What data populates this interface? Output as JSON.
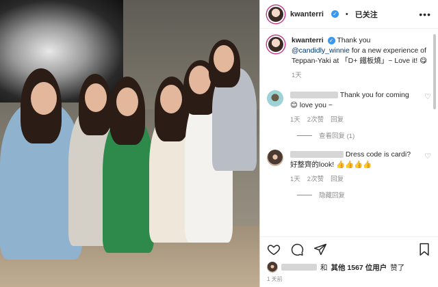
{
  "post": {
    "username": "kwanterri",
    "follow_status": "已关注",
    "verified": true,
    "more_icon": "more-horizontal-icon"
  },
  "caption": {
    "username": "kwanterri",
    "text_before": "Thank you ",
    "mention": "@candidly_winnie",
    "text_after": " for a new experience of Teppan-Yaki at 「D+ 鐵板燒」~ Love it! 😋",
    "time": "1天"
  },
  "comments": [
    {
      "text": "Thank you for coming 😊 love you ~",
      "time": "1天",
      "likes": "2次赞",
      "reply": "回复",
      "view_replies": "查看回复 (1)"
    },
    {
      "text": "Dress code is cardi? 好整齊的look! 👍👍👍👍",
      "time": "1天",
      "likes": "2次赞",
      "reply": "回复",
      "hide_replies": "隐藏回复"
    }
  ],
  "likes_line": {
    "and": "和",
    "count_text": "其他 1567 位用户",
    "suffix": "赞了"
  },
  "timestamp": "1 天前",
  "colors": {
    "verified": "#3897f0",
    "mention": "#00376b",
    "meta": "#8e8e8e"
  }
}
